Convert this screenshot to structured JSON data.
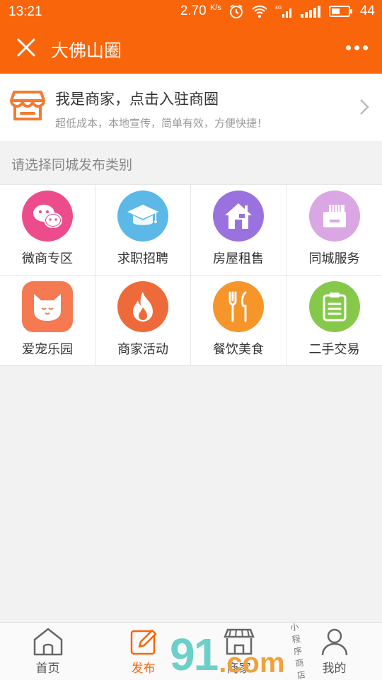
{
  "status_bar": {
    "time": "13:21",
    "speed": "2.70",
    "speed_unit": "K/s",
    "battery": "44",
    "network": "4G"
  },
  "header": {
    "title": "大佛山圈"
  },
  "merchant": {
    "title": "我是商家，点击入驻商圈",
    "subtitle": "超低成本，本地宣传，简单有效，方便快捷！"
  },
  "section": {
    "title": "请选择同城发布类别"
  },
  "categories": [
    {
      "label": "微商专区",
      "icon": "wechat-icon",
      "color": "#ec4c8c"
    },
    {
      "label": "求职招聘",
      "icon": "graduation-cap-icon",
      "color": "#5cb8e6"
    },
    {
      "label": "房屋租售",
      "icon": "house-icon",
      "color": "#9a72e0"
    },
    {
      "label": "同城服务",
      "icon": "printer-icon",
      "color": "#dba6e4"
    },
    {
      "label": "爱宠乐园",
      "icon": "cat-icon",
      "color": "#f57a52"
    },
    {
      "label": "商家活动",
      "icon": "flame-icon",
      "color": "#ef6a3a"
    },
    {
      "label": "餐饮美食",
      "icon": "fork-knife-icon",
      "color": "#f6952a"
    },
    {
      "label": "二手交易",
      "icon": "clipboard-icon",
      "color": "#86c94a"
    }
  ],
  "tabbar": {
    "items": [
      {
        "label": "首页",
        "icon": "home-icon"
      },
      {
        "label": "发布",
        "icon": "edit-icon",
        "active": true
      },
      {
        "label": "商家",
        "icon": "store-icon"
      },
      {
        "label": "我的",
        "icon": "user-icon"
      }
    ]
  },
  "watermark": {
    "main": "91",
    "suffix": ".com",
    "small": "小程序商店"
  },
  "colors": {
    "brand": "#f8650b",
    "background": "#f2f2f2"
  }
}
